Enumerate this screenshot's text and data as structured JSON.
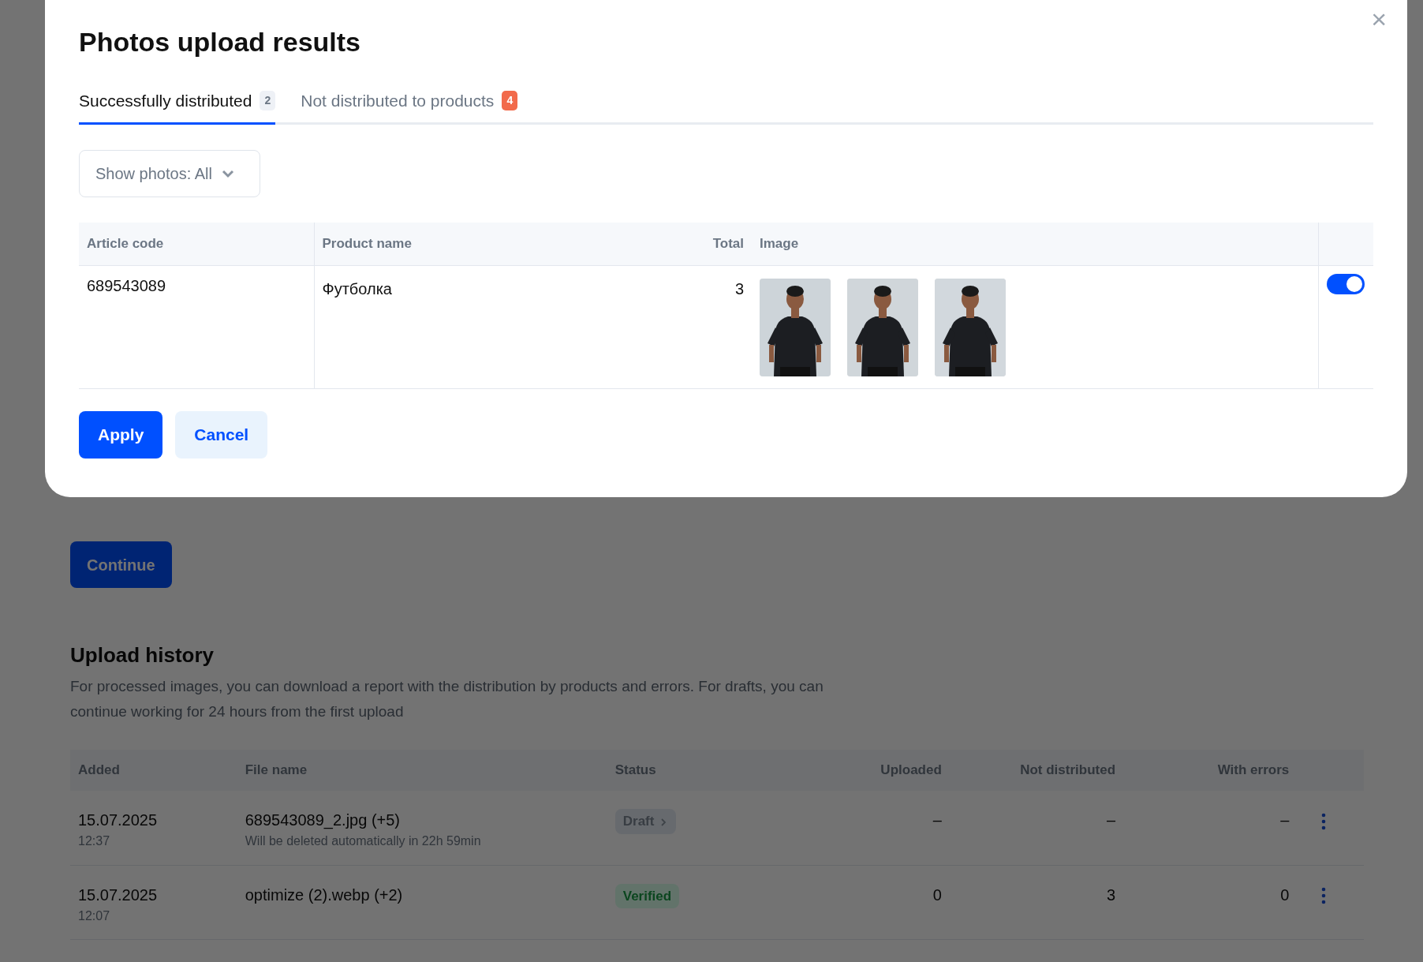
{
  "page": {
    "continue_button": "Continue",
    "history": {
      "title": "Upload history",
      "description": "For processed images, you can download a report with the distribution by products and errors. For drafts, you can continue working for 24 hours from the first upload",
      "columns": [
        "Added",
        "File name",
        "Status",
        "Uploaded",
        "Not distributed",
        "With errors"
      ],
      "rows": [
        {
          "date": "15.07.2025",
          "time": "12:37",
          "file": "689543089_2.jpg (+5)",
          "note": "Will be deleted automatically in 22h 59min",
          "status": "Draft",
          "kind": "draft",
          "color": "#676a6e",
          "uploaded": "–",
          "not_distributed": "–",
          "with_errors": "–"
        },
        {
          "date": "15.07.2025",
          "time": "12:07",
          "file": "optimize (2).webp (+2)",
          "status": "Verified",
          "kind": "verified",
          "color": "#62806a",
          "uploaded": "0",
          "not_distributed": "3",
          "with_errors": "0"
        }
      ]
    }
  },
  "dialog": {
    "title": "Photos upload results",
    "close": "×",
    "tabs": [
      {
        "label": "Successfully distributed",
        "count": "2",
        "selected": true,
        "color": "#eef1f6"
      },
      {
        "label": "Not distributed to products",
        "count": "4",
        "selected": false,
        "color": "#f26a4b"
      }
    ],
    "filter": {
      "label": "Show photos: All"
    },
    "table": {
      "columns": [
        "Article code",
        "Product name",
        "Total",
        "Image"
      ],
      "rows": [
        {
          "article": "689543089",
          "product": "Футболка",
          "total": "3",
          "on": true
        }
      ]
    },
    "buttons": [
      {
        "label": "Apply",
        "kind": "primary"
      },
      {
        "label": "Cancel",
        "kind": "secondary"
      }
    ]
  }
}
